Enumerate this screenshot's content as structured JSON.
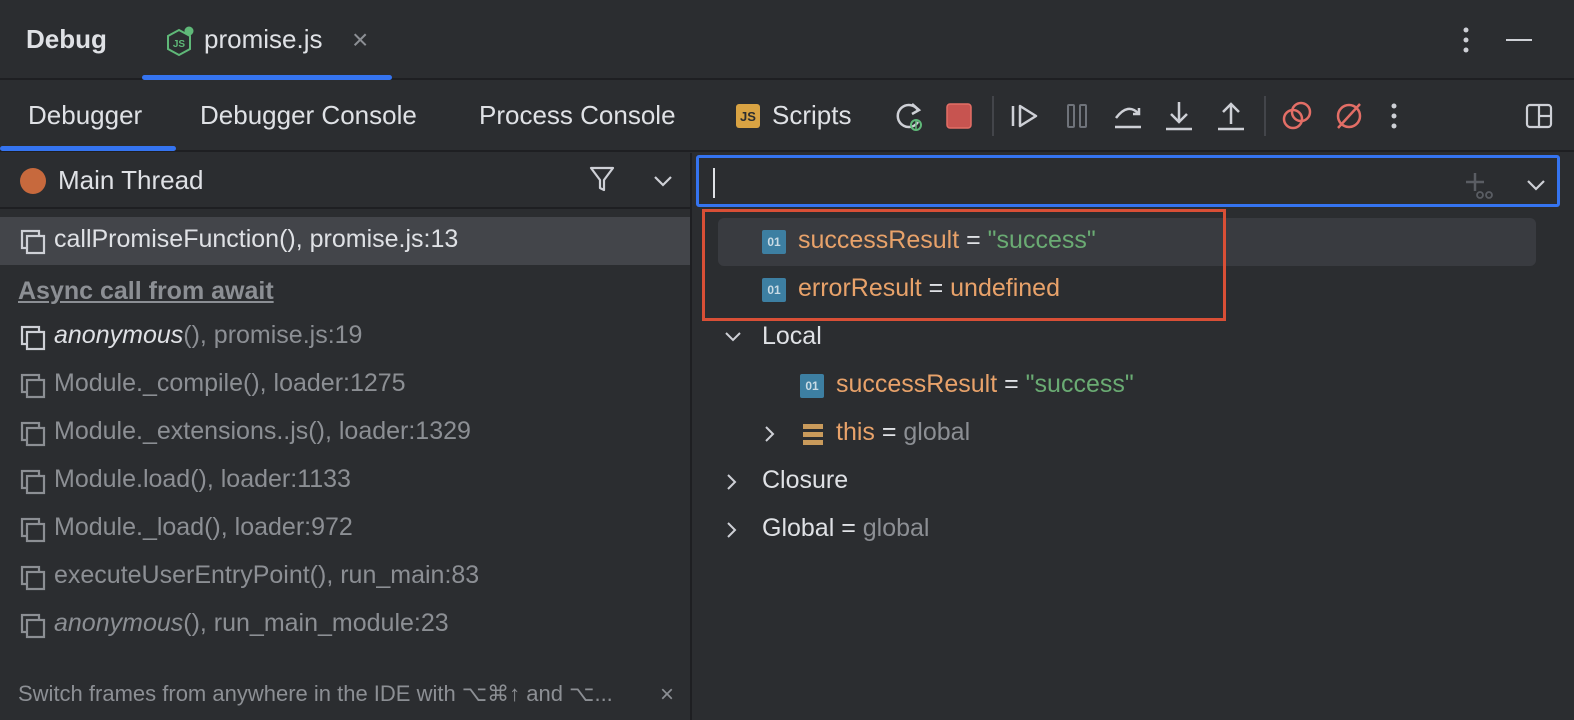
{
  "header": {
    "title": "Debug",
    "file_tab": "promise.js"
  },
  "toolbar": {
    "tabs": [
      "Debugger",
      "Debugger Console",
      "Process Console",
      "Scripts"
    ],
    "scripts_badge": "JS"
  },
  "thread": {
    "name": "Main Thread"
  },
  "frames": {
    "items": [
      {
        "fn": "callPromiseFunction()",
        "loc": ", promise.js:13"
      },
      {
        "fn": "anonymous",
        "loc": "(), promise.js:19"
      },
      {
        "fn": "Module._compile()",
        "loc": ", loader:1275"
      },
      {
        "fn": "Module._extensions..js()",
        "loc": ", loader:1329"
      },
      {
        "fn": "Module.load()",
        "loc": ", loader:1133"
      },
      {
        "fn": "Module._load()",
        "loc": ", loader:972"
      },
      {
        "fn": "executeUserEntryPoint()",
        "loc": ", run_main:83"
      },
      {
        "fn": "anonymous",
        "loc": "(), run_main_module:23"
      }
    ],
    "async_label": "Async call from await",
    "hint": "Switch frames from anywhere in the IDE with ⌥⌘↑ and ⌥..."
  },
  "variables": {
    "watch1": {
      "name": "successResult",
      "eq": " = ",
      "value": "\"success\""
    },
    "watch2": {
      "name": "errorResult",
      "eq": " = ",
      "value": "undefined"
    },
    "local_label": "Local",
    "local1": {
      "name": "successResult",
      "eq": " = ",
      "value": "\"success\""
    },
    "local2": {
      "name": "this",
      "eq": " = ",
      "value": "global"
    },
    "closure_label": "Closure",
    "global_label": "Global",
    "global_eq": " = ",
    "global_value": "global",
    "prim_badge": "01"
  },
  "colors": {
    "accent": "#3574f0",
    "highlight_box": "#d94f36",
    "thread_dot": "#c7693d",
    "var_name": "#e8a26a",
    "string_value": "#6aab73"
  }
}
